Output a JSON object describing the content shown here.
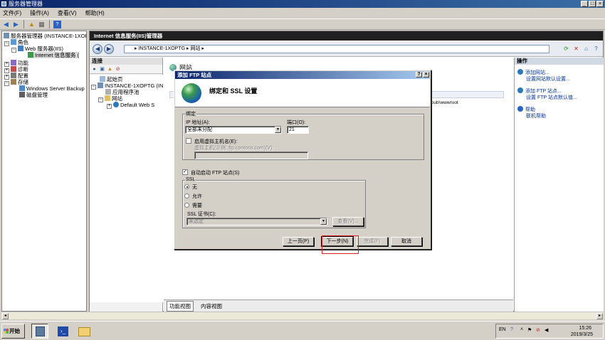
{
  "window": {
    "title": "服务器管理器",
    "controls": {
      "minimize": "_",
      "maximize": "□",
      "close": "×"
    }
  },
  "menubar": [
    {
      "label": "文件(F)"
    },
    {
      "label": "操作(A)"
    },
    {
      "label": "查看(V)"
    },
    {
      "label": "帮助(H)"
    }
  ],
  "tree": {
    "items": [
      {
        "label": "服务器管理器 (INSTANCE-1XOPT"
      },
      {
        "label": "角色"
      },
      {
        "label": "Web 服务器(IIS)"
      },
      {
        "label": "Internet 信息服务 ("
      },
      {
        "label": "功能"
      },
      {
        "label": "诊断"
      },
      {
        "label": "配置"
      },
      {
        "label": "存储"
      },
      {
        "label": "Windows Server Backup"
      },
      {
        "label": "磁盘管理"
      }
    ]
  },
  "iis": {
    "header": "Internet 信息服务(IIS)管理器",
    "address": {
      "path": "▸ INSTANCE-1XOPTG ▸ 网站 ▸"
    },
    "connections": {
      "title": "连接",
      "tree": [
        "起始页",
        "INSTANCE-1XOPTG (INS",
        "应用程序池",
        "网站",
        "Default Web S"
      ]
    },
    "center": {
      "title": "网站",
      "path_fragment": "tpub\\wwwroot"
    },
    "view_tabs": [
      {
        "label": "功能视图"
      },
      {
        "label": "内容视图"
      }
    ],
    "actions": {
      "title": "操作",
      "items": [
        {
          "label": "添加网站..."
        },
        {
          "label": "设置网站默认设置..."
        },
        {
          "label": "添加 FTP 站点..."
        },
        {
          "label": "设置 FTP 站点默认值..."
        },
        {
          "label": "帮助"
        },
        {
          "label": "联机帮助"
        }
      ]
    }
  },
  "dialog": {
    "title": "添加 FTP 站点",
    "title_buttons": {
      "help": "?",
      "close": "×"
    },
    "heading": "绑定和 SSL 设置",
    "binding": {
      "legend": "绑定",
      "ip_label": "IP 地址(A):",
      "ip_value": "全部未分配",
      "port_label": "端口(O):",
      "port_value": "21",
      "virtual_host_check_label": "启用虚拟主机名(E):",
      "virtual_host_label": "虚拟主机(示例: ftp.contoso.com)(V):",
      "virtual_host_value": ""
    },
    "auto_start_label": "自动启动 FTP 站点(S)",
    "ssl": {
      "legend": "SSL",
      "options": [
        {
          "label": "无",
          "selected": true
        },
        {
          "label": "允许",
          "selected": false
        },
        {
          "label": "需要",
          "selected": false
        }
      ],
      "cert_label": "SSL 证书(C):",
      "cert_value": "未选定",
      "view_button": "查看(V)..."
    },
    "buttons": {
      "prev": "上一页(P)",
      "next": "下一步(N)",
      "finish": "完成(F)",
      "cancel": "取消"
    }
  },
  "taskbar": {
    "start_label": "开始",
    "tray": {
      "lang": "EN",
      "time": "15:26",
      "date": "2019/3/25"
    }
  }
}
